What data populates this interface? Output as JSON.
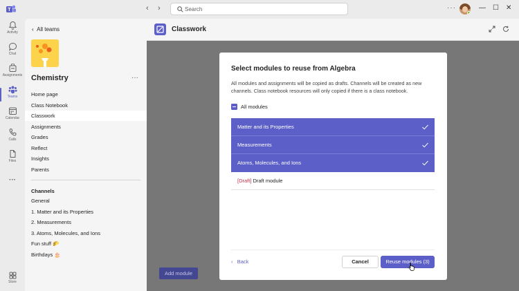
{
  "titlebar": {
    "search_placeholder": "Search"
  },
  "rail": {
    "items": [
      {
        "label": "Activity",
        "icon": "bell-icon"
      },
      {
        "label": "Chat",
        "icon": "chat-icon"
      },
      {
        "label": "Assignments",
        "icon": "assignments-icon"
      },
      {
        "label": "Teams",
        "icon": "teams-icon",
        "active": true
      },
      {
        "label": "Calendar",
        "icon": "calendar-icon"
      },
      {
        "label": "Calls",
        "icon": "phone-icon"
      },
      {
        "label": "Files",
        "icon": "file-icon"
      }
    ],
    "store_label": "Store"
  },
  "panel": {
    "back_label": "All teams",
    "team_name": "Chemistry",
    "nav": [
      "Home page",
      "Class Notebook",
      "Classwork",
      "Assignments",
      "Grades",
      "Reflect",
      "Insights",
      "Parents"
    ],
    "active_nav": "Classwork",
    "channels_title": "Channels",
    "channels": [
      "General",
      "1. Matter and its Properties",
      "2. Measurements",
      "3. Atoms, Molecules, and Ions",
      "Fun stuff 🌮",
      "Birthdays 🎂"
    ]
  },
  "main": {
    "title": "Classwork",
    "add_module_label": "Add module"
  },
  "dialog": {
    "title": "Select modules to reuse from Algebra",
    "description": "All modules and assignments will be copied as drafts. Channels will be created as new channels. Class notebook resources will only copied if there is a class notebook.",
    "all_modules_label": "All modules",
    "modules": [
      {
        "name": "Matter and its Properties",
        "selected": true
      },
      {
        "name": "Measurements",
        "selected": true
      },
      {
        "name": "Atoms, Molecules, and Ions",
        "selected": true
      }
    ],
    "draft_module": {
      "tag": "[Draft]",
      "name": "Draft module"
    },
    "back_label": "Back",
    "cancel_label": "Cancel",
    "reuse_label": "Reuse modules (3)"
  },
  "colors": {
    "accent": "#5b5fc7",
    "accent_dark": "#444791",
    "draft_tag": "#c4314b"
  }
}
